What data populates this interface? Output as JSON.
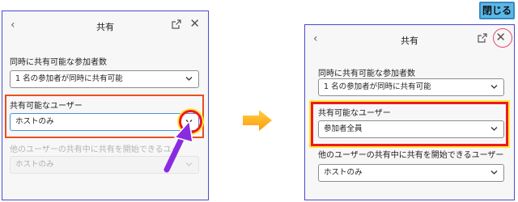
{
  "left_panel": {
    "header": {
      "title": "共有",
      "back_icon": "chevron-left-icon",
      "external_icon": "open-external-icon",
      "close_icon": "close-icon"
    },
    "concurrent": {
      "label": "同時に共有可能な参加者数",
      "value": "1 名の参加者が同時に共有可能"
    },
    "who_can_share": {
      "label": "共有可能なユーザー",
      "value": "ホストのみ"
    },
    "start_when_other_sharing": {
      "label": "他のユーザーの共有中に共有を開始できるユー",
      "value": "ホストのみ"
    }
  },
  "right_panel": {
    "callout": "閉じる",
    "header": {
      "title": "共有",
      "back_icon": "chevron-left-icon",
      "external_icon": "open-external-icon",
      "close_icon": "close-icon"
    },
    "concurrent": {
      "label": "同時に共有可能な参加者数",
      "value": "1 名の参加者が同時に共有可能"
    },
    "who_can_share": {
      "label": "共有可能なユーザー",
      "value": "参加者全員"
    },
    "start_when_other_sharing": {
      "label": "他のユーザーの共有中に共有を開始できるユーザー",
      "value": "ホストのみ"
    }
  },
  "colors": {
    "highlight_orange": "#e8501e",
    "highlight_red": "#f01820",
    "highlight_yellow": "#ffe83a",
    "panel_border": "#4a4ad0",
    "arrow_orange": "#ffb020",
    "pointer_purple": "#8a2be2",
    "callout_blue": "#5ab8e8"
  }
}
